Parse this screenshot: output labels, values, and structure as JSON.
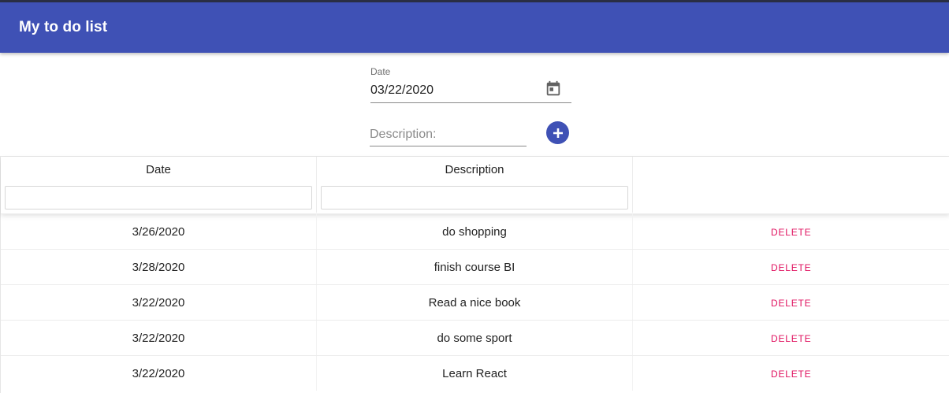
{
  "app": {
    "title": "My to do list"
  },
  "form": {
    "date_label": "Date",
    "date_value": "03/22/2020",
    "calendar_icon": "calendar-icon",
    "description_placeholder": "Description:",
    "add_icon": "add-circle-icon"
  },
  "colors": {
    "primary": "#3f51b5",
    "delete": "#e0115f"
  },
  "table": {
    "columns": [
      "Date",
      "Description",
      ""
    ],
    "rows": [
      {
        "date": "3/26/2020",
        "description": "do shopping",
        "action": "DELETE"
      },
      {
        "date": "3/28/2020",
        "description": "finish course BI",
        "action": "DELETE"
      },
      {
        "date": "3/22/2020",
        "description": "Read a nice book",
        "action": "DELETE"
      },
      {
        "date": "3/22/2020",
        "description": "do some sport",
        "action": "DELETE"
      },
      {
        "date": "3/22/2020",
        "description": "Learn React",
        "action": "DELETE"
      }
    ]
  }
}
